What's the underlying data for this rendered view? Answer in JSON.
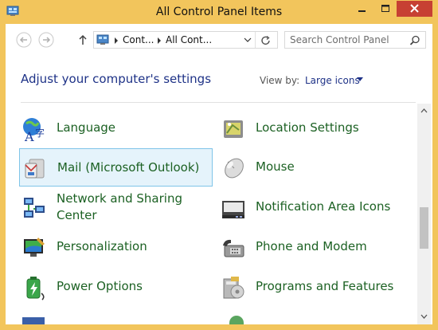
{
  "window": {
    "title": "All Control Panel Items",
    "accent": "#f2c55c",
    "close_color": "#c74033"
  },
  "nav": {
    "breadcrumb": [
      "Cont...",
      "All Cont..."
    ],
    "search_placeholder": "Search Control Panel"
  },
  "header": {
    "heading": "Adjust your computer's settings",
    "view_by_label": "View by:",
    "view_by_value": "Large icons"
  },
  "items": [
    {
      "label": "Language",
      "icon": "language-icon"
    },
    {
      "label": "Location Settings",
      "icon": "location-settings-icon"
    },
    {
      "label": "Mail (Microsoft Outlook)",
      "icon": "mail-icon",
      "selected": true
    },
    {
      "label": "Mouse",
      "icon": "mouse-icon"
    },
    {
      "label": "Network and Sharing Center",
      "icon": "network-icon"
    },
    {
      "label": "Notification Area Icons",
      "icon": "notification-area-icon"
    },
    {
      "label": "Personalization",
      "icon": "personalization-icon"
    },
    {
      "label": "Phone and Modem",
      "icon": "phone-modem-icon"
    },
    {
      "label": "Power Options",
      "icon": "power-options-icon"
    },
    {
      "label": "Programs and Features",
      "icon": "programs-features-icon"
    }
  ],
  "colors": {
    "link_green": "#1c6123",
    "heading_blue": "#1e3287",
    "selection_bg": "#e5f3fb",
    "selection_border": "#7fc4e8"
  }
}
